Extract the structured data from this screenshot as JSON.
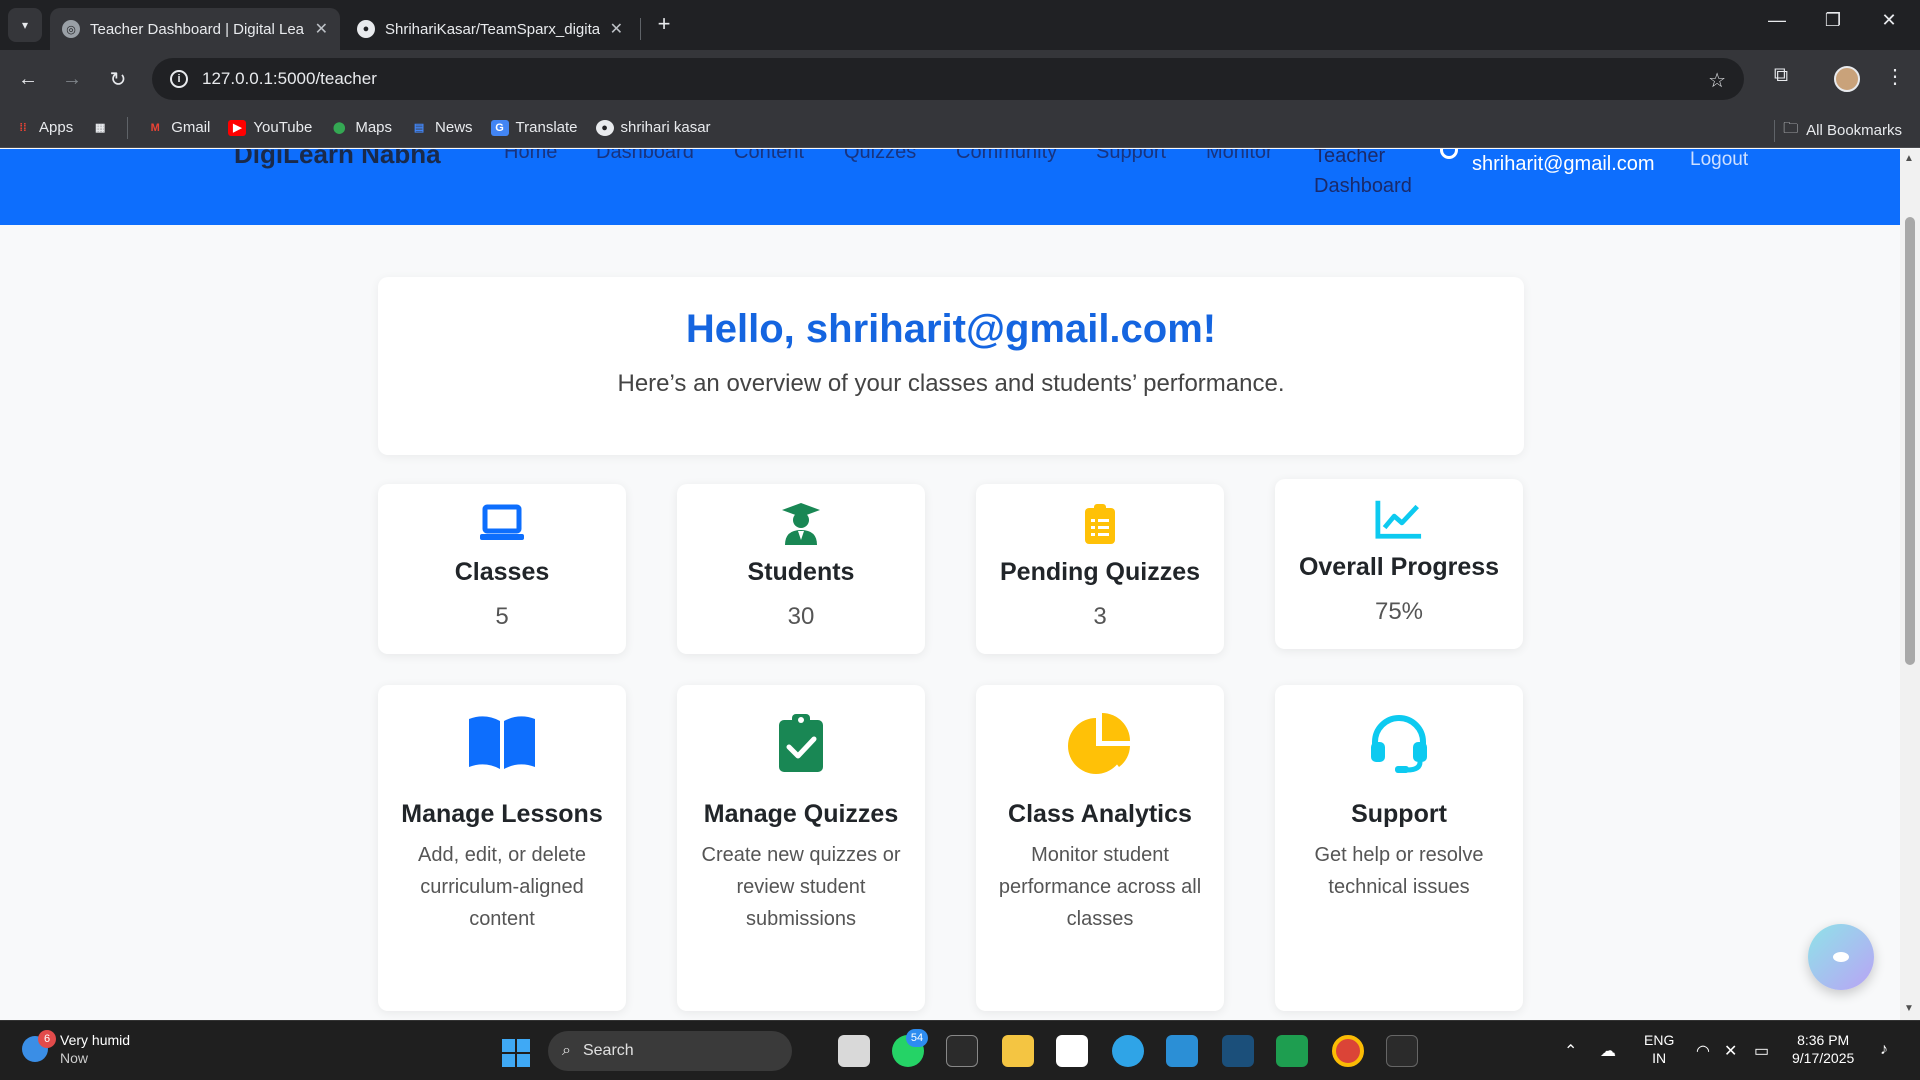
{
  "browser": {
    "tabs": [
      {
        "title": "Teacher Dashboard | Digital Lea",
        "active": true
      },
      {
        "title": "ShrihariKasar/TeamSparx_digita",
        "active": false
      }
    ],
    "url": "127.0.0.1:5000/teacher",
    "bookmarks": [
      {
        "label": "Apps",
        "icon": "apps-grid-icon"
      },
      {
        "label": "Gmail",
        "icon": "gmail-icon"
      },
      {
        "label": "YouTube",
        "icon": "youtube-icon"
      },
      {
        "label": "Maps",
        "icon": "maps-icon"
      },
      {
        "label": "News",
        "icon": "news-icon"
      },
      {
        "label": "Translate",
        "icon": "translate-icon"
      },
      {
        "label": "shrihari kasar",
        "icon": "github-icon"
      }
    ],
    "all_bookmarks": "All Bookmarks"
  },
  "navbar": {
    "brand": "DigiLearn Nabha",
    "links": [
      "Home",
      "Dashboard",
      "Content",
      "Quizzes",
      "Community",
      "Support",
      "Monitor"
    ],
    "teacher_link": "Teacher Dashboard",
    "user_email": "shriharit@gmail.com",
    "logout": "Logout",
    "accent": "#0d6efd"
  },
  "hero": {
    "greeting": "Hello, shriharit@gmail.com!",
    "subtitle": "Here’s an overview of your classes and students’ performance."
  },
  "stats": [
    {
      "label": "Classes",
      "value": "5",
      "icon": "laptop-icon",
      "color": "#0d6efd"
    },
    {
      "label": "Students",
      "value": "30",
      "icon": "graduate-icon",
      "color": "#198754"
    },
    {
      "label": "Pending Quizzes",
      "value": "3",
      "icon": "clipboard-list-icon",
      "color": "#ffc107"
    },
    {
      "label": "Overall Progress",
      "value": "75%",
      "icon": "chart-line-icon",
      "color": "#0dcaf0"
    }
  ],
  "actions": [
    {
      "label": "Manage Lessons",
      "desc": "Add, edit, or delete curriculum-aligned content",
      "icon": "book-open-icon",
      "color": "#0d6efd"
    },
    {
      "label": "Manage Quizzes",
      "desc": "Create new quizzes or review student submissions",
      "icon": "clipboard-check-icon",
      "color": "#198754"
    },
    {
      "label": "Class Analytics",
      "desc": "Monitor student performance across all classes",
      "icon": "pie-chart-icon",
      "color": "#ffc107"
    },
    {
      "label": "Support",
      "desc": "Get help or resolve technical issues",
      "icon": "headset-icon",
      "color": "#0dcaf0"
    }
  ],
  "taskbar": {
    "weather_title": "Very humid",
    "weather_sub": "Now",
    "weather_badge": "6",
    "search": "Search",
    "whatsapp_badge": "54",
    "lang_top": "ENG",
    "lang_bottom": "IN",
    "time": "8:36 PM",
    "date": "9/17/2025"
  }
}
